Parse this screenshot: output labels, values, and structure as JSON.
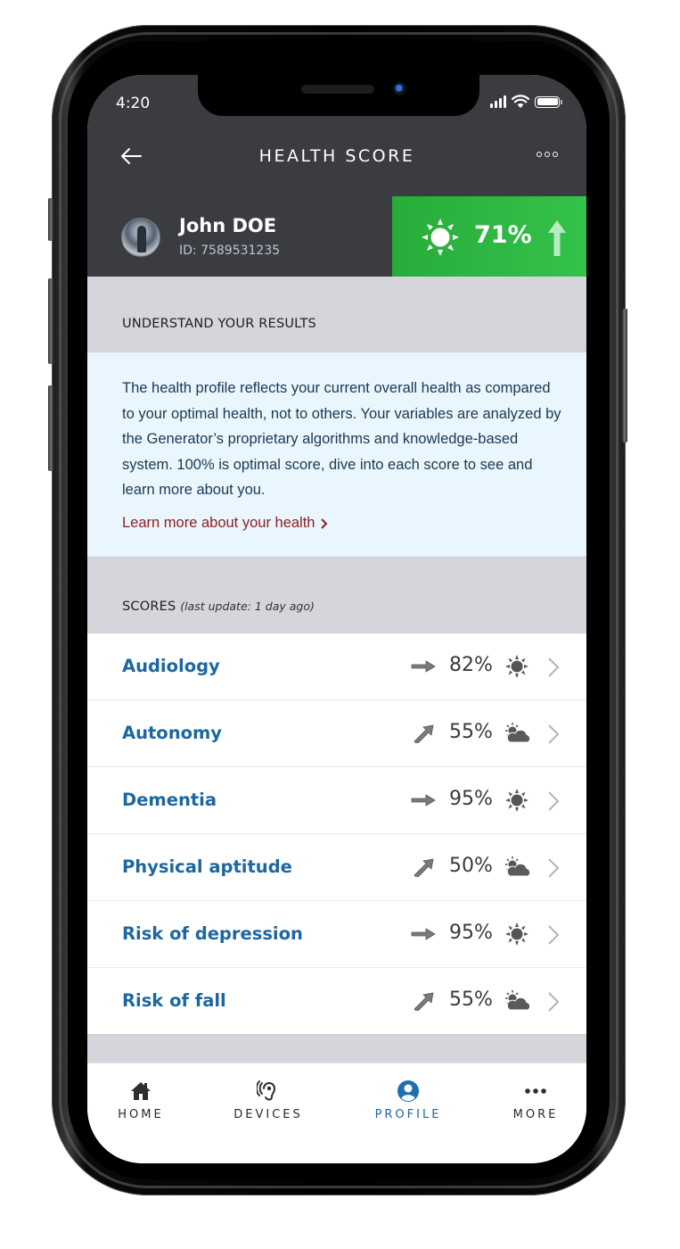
{
  "status_bar": {
    "time": "4:20"
  },
  "header": {
    "title": "HEALTH SCORE",
    "back_icon": "arrow-left-icon",
    "more_icon": "more-dots-icon"
  },
  "user": {
    "name": "John DOE",
    "id_label": "ID: 7589531235",
    "overall_score": "71%",
    "overall_weather_icon": "sun-icon",
    "overall_trend_icon": "arrow-up-icon",
    "score_color": "#2fb843"
  },
  "understand": {
    "heading": "UNDERSTAND YOUR RESULTS",
    "body": "The health profile reflects your current overall health as compared to your optimal health, not to others. Your variables are analyzed by the Generator’s proprietary algorithms and knowledge-based system. 100% is optimal score, dive into each score to see and learn more about you.",
    "link": "Learn more about your health"
  },
  "scores": {
    "heading": "SCORES",
    "last_update": "(last update: 1 day ago)",
    "items": [
      {
        "name": "Audiology",
        "value": "82%",
        "trend": "flat",
        "weather": "sun"
      },
      {
        "name": "Autonomy",
        "value": "55%",
        "trend": "up",
        "weather": "partly-cloudy"
      },
      {
        "name": "Dementia",
        "value": "95%",
        "trend": "flat",
        "weather": "sun"
      },
      {
        "name": "Physical aptitude",
        "value": "50%",
        "trend": "up",
        "weather": "partly-cloudy"
      },
      {
        "name": "Risk of depression",
        "value": "95%",
        "trend": "flat",
        "weather": "sun"
      },
      {
        "name": "Risk of fall",
        "value": "55%",
        "trend": "up",
        "weather": "partly-cloudy"
      }
    ]
  },
  "tabbar": {
    "active": "profile",
    "active_color": "#1d67a0",
    "items": [
      {
        "key": "home",
        "label": "HOME",
        "icon": "home-icon"
      },
      {
        "key": "devices",
        "label": "DEVICES",
        "icon": "ear-icon"
      },
      {
        "key": "profile",
        "label": "PROFILE",
        "icon": "user-icon"
      },
      {
        "key": "more",
        "label": "MORE",
        "icon": "more-dots-icon"
      }
    ]
  }
}
